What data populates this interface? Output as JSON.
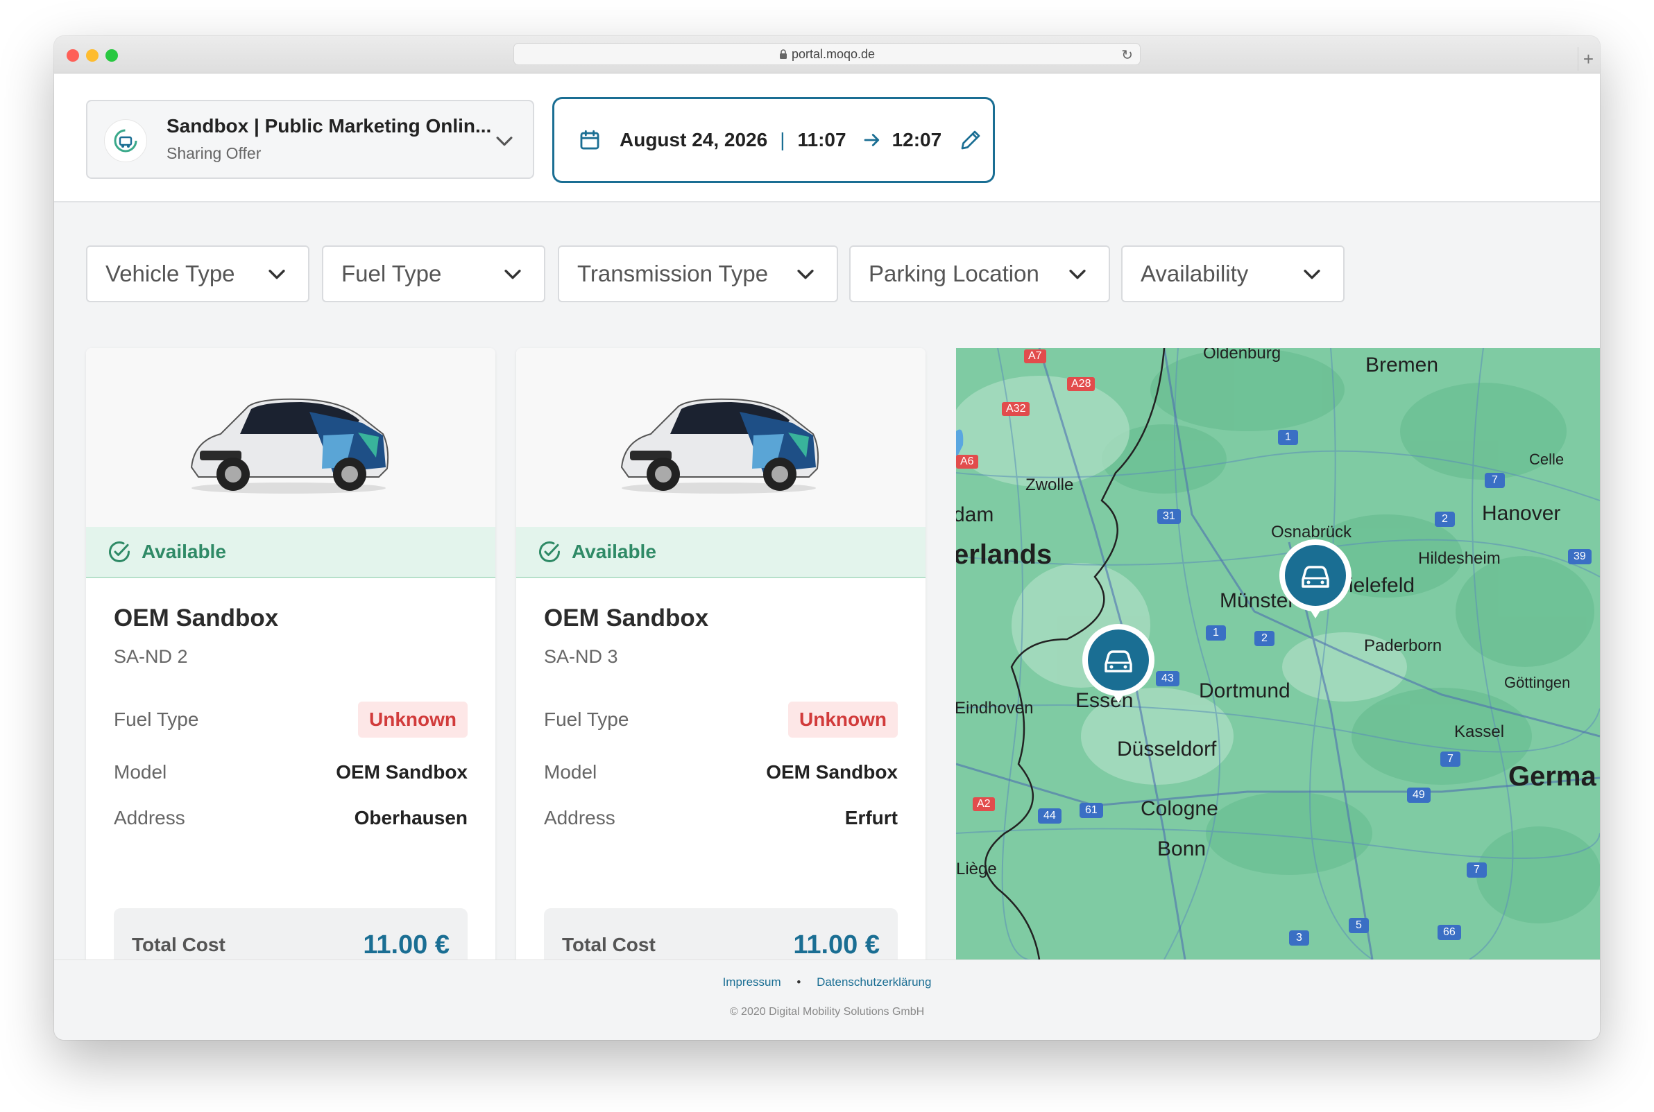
{
  "browser": {
    "url": "portal.moqo.de"
  },
  "header": {
    "org_name": "Sandbox | Public Marketing Onlin...",
    "org_subtitle": "Sharing Offer",
    "date": "August 24, 2026",
    "separator": "|",
    "start_time": "11:07",
    "end_time": "12:07"
  },
  "filters": [
    "Vehicle Type",
    "Fuel Type",
    "Transmission Type",
    "Parking Location",
    "Availability"
  ],
  "cards": [
    {
      "status": "Available",
      "title": "OEM Sandbox",
      "plate": "SA-ND 2",
      "fuel_label": "Fuel Type",
      "fuel_value": "Unknown",
      "model_label": "Model",
      "model_value": "OEM Sandbox",
      "address_label": "Address",
      "address_value": "Oberhausen",
      "total_label": "Total Cost",
      "total_value": "11.00 €"
    },
    {
      "status": "Available",
      "title": "OEM Sandbox",
      "plate": "SA-ND 3",
      "fuel_label": "Fuel Type",
      "fuel_value": "Unknown",
      "model_label": "Model",
      "model_value": "OEM Sandbox",
      "address_label": "Address",
      "address_value": "Erfurt",
      "total_label": "Total Cost",
      "total_value": "11.00 €"
    }
  ],
  "map": {
    "cities": {
      "oldenburg": "Oldenburg",
      "bremen": "Bremen",
      "celle": "Celle",
      "zwolle": "Zwolle",
      "dam": "dam",
      "erlands": "erlands",
      "osnabruck": "Osnabrück",
      "hanover": "Hanover",
      "hildesheim": "Hildesheim",
      "munster": "Münster",
      "bielefeld": "Bielefeld",
      "paderborn": "Paderborn",
      "gottingen": "Göttingen",
      "eindhoven": "Eindhoven",
      "essen": "Essen",
      "dortmund": "Dortmund",
      "kassel": "Kassel",
      "dusseldorf": "Düsseldorf",
      "germa": "Germa",
      "cologne": "Cologne",
      "bonn": "Bonn",
      "liege": "Liège"
    },
    "road_badges": {
      "a7": "A7",
      "a28": "A28",
      "a32": "A32",
      "a6": "A6",
      "a2": "A2",
      "r1a": "1",
      "r1b": "1",
      "r7a": "7",
      "r2a": "2",
      "r2b": "2",
      "r31": "31",
      "r39": "39",
      "r43": "43",
      "r7b": "7",
      "r49": "49",
      "r44": "44",
      "r61": "61",
      "r7c": "7",
      "r3": "3",
      "r5": "5",
      "r66": "66"
    }
  },
  "footer": {
    "impressum": "Impressum",
    "dot": "•",
    "privacy": "Datenschutzerklärung",
    "copyright": "© 2020 Digital Mobility Solutions GmbH"
  },
  "colors": {
    "primary": "#1a6e93",
    "available_bg": "#e3f4ec",
    "available_text": "#2f8a66",
    "unknown_bg": "#fde7e7",
    "unknown_text": "#d13b3b",
    "map_green": "#7cc9a0"
  },
  "icons": {
    "calendar": "calendar-icon",
    "arrow": "arrow-right-icon",
    "edit": "pencil-icon",
    "chevron": "chevron-down-icon",
    "check": "check-circle-icon",
    "car_marker": "car-marker-icon"
  }
}
